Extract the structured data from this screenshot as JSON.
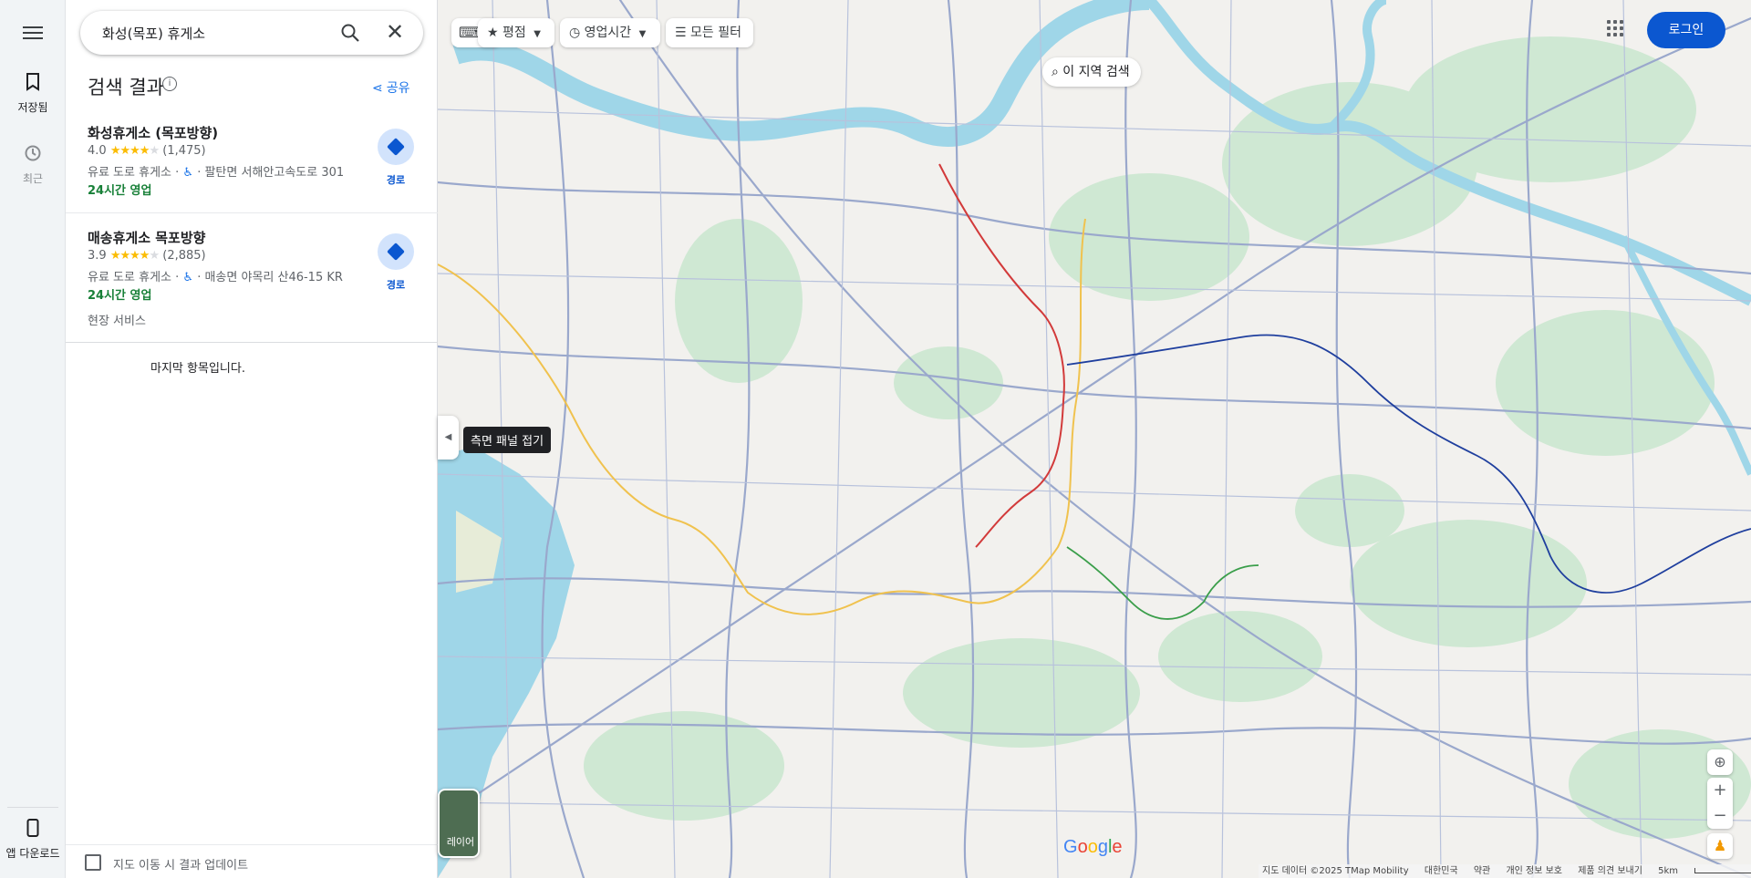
{
  "search": {
    "query": "화성(목포) 휴게소"
  },
  "rail": {
    "saved_label": "저장됨",
    "recent_label": "최근",
    "download_label": "앱 다운로드"
  },
  "panel": {
    "results_title": "검색 결과",
    "share_label": "공유",
    "results": [
      {
        "name": "화성휴게소 (목포방향)",
        "rating": "4.0",
        "reviews": "(1,475)",
        "category": "유료 도로 휴게소",
        "address": "팔탄면 서해안고속도로 301",
        "hours": "24시간 영업",
        "directions": "경로"
      },
      {
        "name": "매송휴게소 목포방향",
        "rating": "3.9",
        "reviews": "(2,885)",
        "category": "유료 도로 휴게소",
        "address": "매송면 야목리 산46-15 KR",
        "hours": "24시간 영업",
        "extra": "현장 서비스",
        "directions": "경로"
      }
    ],
    "end_of_list": "마지막 항목입니다.",
    "update_on_move_label": "지도 이동 시 결과 업데이트"
  },
  "map": {
    "chips": {
      "rating": "평점",
      "hours": "영업시간",
      "all_filters": "모든 필터"
    },
    "search_area": "이 지역 검색",
    "collapse_tooltip": "측면 패널 접기",
    "login": "로그인",
    "layers_label": "레이어",
    "attribution": [
      "지도 데이터 ©2025 TMap Mobility",
      "대한민국",
      "약관",
      "개인 정보 보호",
      "제품 의견 보내기",
      "5km"
    ]
  },
  "colors": {
    "accent": "#0b57d0",
    "open_green": "#188038",
    "star": "#fbbc04",
    "water": "#9fd6e8",
    "park": "#cfe8d3"
  }
}
